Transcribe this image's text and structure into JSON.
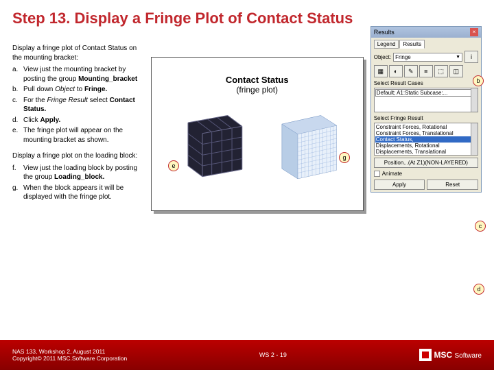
{
  "title": "Step 13. Display a Fringe Plot of Contact Status",
  "intro1": "Display a fringe plot of Contact Status on the mounting bracket:",
  "steps1": [
    {
      "m": "a.",
      "t": "View just the mounting bracket by posting the group Mounting_bracket"
    },
    {
      "m": "b.",
      "t": "Pull down Object to Fringe."
    },
    {
      "m": "c.",
      "t": "For the Fringe Result select Contact Status."
    },
    {
      "m": "d.",
      "t": "Click Apply."
    },
    {
      "m": "e.",
      "t": "The fringe plot will appear on the mounting bracket as shown."
    }
  ],
  "intro2": "Display a fringe plot on the loading block:",
  "steps2": [
    {
      "m": "f.",
      "t": "View just the loading block by posting the group Loading_block."
    },
    {
      "m": "g.",
      "t": "When the block appears it will be displayed with the fringe plot."
    }
  ],
  "figure": {
    "title": "Contact Status",
    "sub": "(fringe plot)"
  },
  "panel": {
    "title": "Results",
    "tabs": [
      "Legend",
      "Results"
    ],
    "object_lbl": "Object:",
    "object_val": "Fringe",
    "cases_title": "Select Result Cases",
    "cases": [
      "Default; A1:Static Subcase:..."
    ],
    "fringe_title": "Select Fringe Result",
    "fringe_items": [
      "Constraint Forces, Rotational",
      "Constraint Forces, Translational",
      "Contact Status,",
      "Displacements, Rotational",
      "Displacements, Translational"
    ],
    "position_btn": "Position...(At Z1)(NON-LAYERED)",
    "animate": "Animate",
    "apply": "Apply",
    "reset": "Reset"
  },
  "callouts": {
    "b": "b",
    "c": "c",
    "d": "d",
    "e": "e",
    "g": "g"
  },
  "footer": {
    "line1": "NAS 133, Workshop 2, August 2011",
    "line2": "Copyright© 2011 MSC.Software Corporation",
    "mid": "WS 2 - 19",
    "brand": "MSC Software"
  }
}
